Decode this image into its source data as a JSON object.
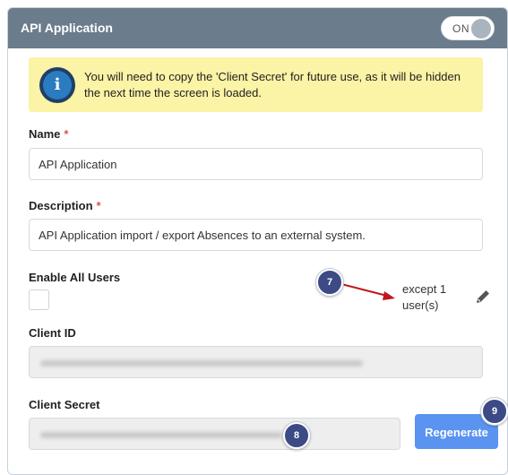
{
  "header": {
    "title": "API Application",
    "toggle_label": "ON"
  },
  "alert": {
    "icon": "info-icon",
    "icon_glyph": "i",
    "message": "You will need to copy the 'Client Secret' for future use, as it will be hidden the next time the screen is loaded."
  },
  "form": {
    "name": {
      "label": "Name",
      "required_mark": "*",
      "value": "API Application"
    },
    "description": {
      "label": "Description",
      "required_mark": "*",
      "value": "API Application import / export Absences to an external system."
    },
    "enable_all_users": {
      "label": "Enable All Users",
      "checked": false,
      "except_text": "except 1 user(s)",
      "edit_icon": "pencil-icon"
    },
    "client_id": {
      "label": "Client ID"
    },
    "client_secret": {
      "label": "Client Secret",
      "regenerate_label": "Regenerate"
    }
  },
  "annotations": {
    "badge_7": "7",
    "badge_8": "8",
    "badge_9": "9",
    "arrow_color": "#c0161d"
  }
}
